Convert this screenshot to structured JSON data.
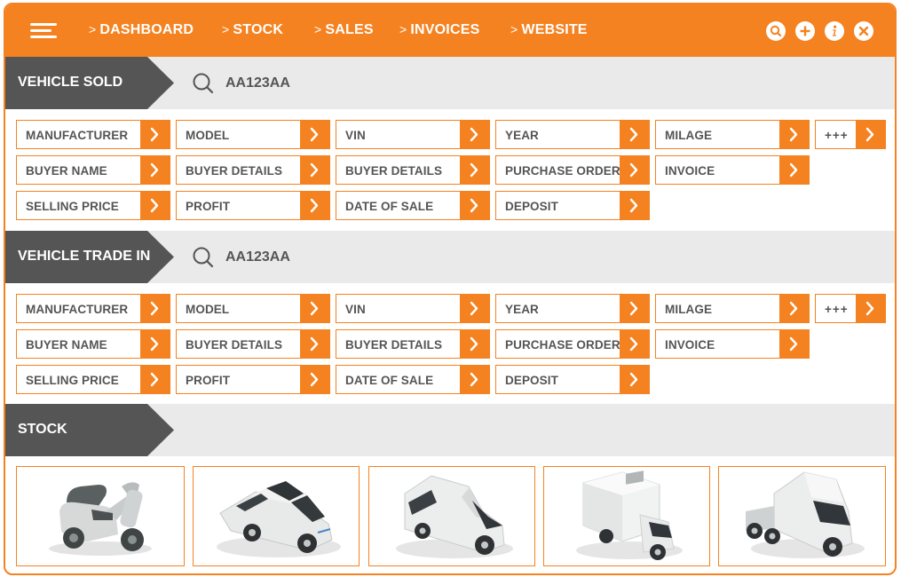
{
  "nav": {
    "items": [
      {
        "label": "DASHBOARD"
      },
      {
        "label": "STOCK"
      },
      {
        "label": "SALES"
      },
      {
        "label": "INVOICES"
      },
      {
        "label": "WEBSITE"
      }
    ],
    "chevron": ">",
    "icons": [
      "search-icon",
      "plus-icon",
      "info-icon",
      "close-icon"
    ]
  },
  "sold": {
    "title": "VEHICLE SOLD",
    "search_value": "AA123AA",
    "fields": [
      "MANUFACTURER",
      "MODEL",
      "VIN",
      "YEAR",
      "MILAGE",
      "+++",
      "BUYER NAME",
      "BUYER DETAILS",
      "BUYER DETAILS",
      "PURCHASE ORDER",
      "INVOICE",
      "SELLING PRICE",
      "PROFIT",
      "DATE OF SALE",
      "DEPOSIT"
    ]
  },
  "tradein": {
    "title": "VEHICLE TRADE IN",
    "search_value": "AA123AA",
    "fields": [
      "MANUFACTURER",
      "MODEL",
      "VIN",
      "YEAR",
      "MILAGE",
      "+++",
      "BUYER NAME",
      "BUYER DETAILS",
      "BUYER DETAILS",
      "PURCHASE ORDER",
      "INVOICE",
      "SELLING PRICE",
      "PROFIT",
      "DATE OF SALE",
      "DEPOSIT"
    ]
  },
  "stock": {
    "title": "STOCK",
    "vehicles": [
      "scooter",
      "sedan",
      "van",
      "box-truck",
      "semi-truck"
    ]
  },
  "colors": {
    "accent": "#f58220",
    "dark_tag": "#555555",
    "section_bg": "#eaeaea",
    "text": "#555555"
  }
}
